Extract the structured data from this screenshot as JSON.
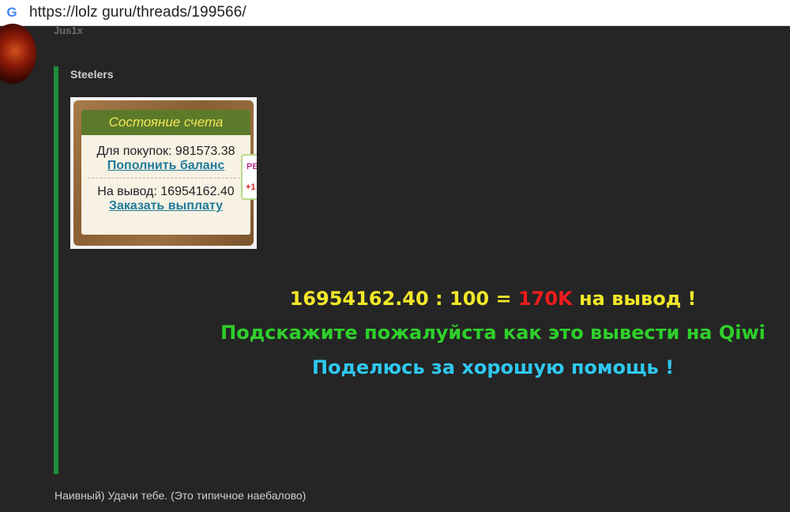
{
  "browser": {
    "url": "https://lolz guru/threads/199566/",
    "favicon_icon": "google-g-icon"
  },
  "post": {
    "author": "Jus1x",
    "quote": {
      "author": "Steelers",
      "image": {
        "header": "Состояние счета",
        "purchase_label": "Для покупок: 981573.38",
        "topup_link": "Пополнить баланс",
        "withdraw_label": "На вывод: 16954162.40",
        "payout_link": "Заказать выплату",
        "badge_top": "РЕ",
        "badge_bottom": "+1"
      },
      "message": {
        "line1_prefix": "16954162.40 : 100 = ",
        "line1_highlight": "170K",
        "line1_suffix": " на вывод !",
        "line2": "Подскажите пожалуйста как это вывести на Qiwi",
        "line3": "Поделюсь за хорошую помощь !"
      }
    },
    "reply": "Наивный) Удачи тебе. (Это типичное наебалово)"
  },
  "colors": {
    "quote_bar": "#1f8f3a",
    "line1": "#f2e82a",
    "highlight": "#f01c1c",
    "line2": "#2fcf2a",
    "line3": "#2fc8f0"
  }
}
